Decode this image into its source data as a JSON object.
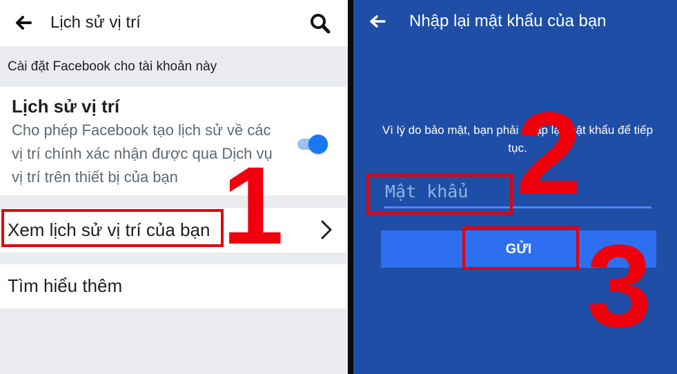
{
  "left": {
    "header": {
      "back_icon": "arrow-left-icon",
      "title": "Lịch sử vị trí",
      "search_icon": "search-icon"
    },
    "section_label": "Cài đặt Facebook cho tài khoản này",
    "location_history": {
      "title": "Lịch sử vị trí",
      "description": "Cho phép Facebook tạo lịch sử về các vị trí chính xác nhận được qua Dịch vụ vị trí trên thiết bị của bạn",
      "toggle_on": true
    },
    "view_history_label": "Xem lịch sử vị trí của bạn",
    "chevron_icon": "chevron-right-icon",
    "learn_more_label": "Tìm hiểu thêm"
  },
  "right": {
    "header": {
      "back_icon": "arrow-left-icon",
      "title": "Nhập lại mật khẩu của bạn"
    },
    "description": "Vì lý do bảo mật, bạn phải nhập lại mật khẩu để tiếp tục.",
    "password_placeholder": "Mật khẩu",
    "send_label": "GỬI"
  },
  "steps": [
    "1",
    "2",
    "3"
  ],
  "colors": {
    "accent_red": "#e3000b",
    "facebook_blue": "#1877f2",
    "dialog_bg": "#1f4ea6",
    "button_blue": "#2d6ff0"
  }
}
